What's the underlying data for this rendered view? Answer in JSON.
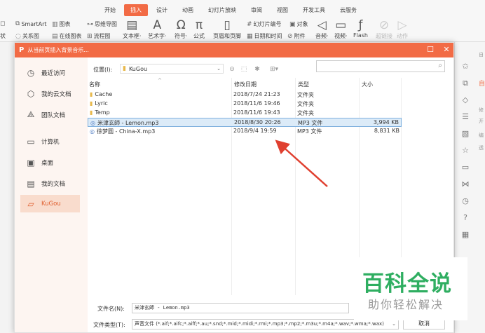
{
  "ribbon": {
    "tabs": [
      "开始",
      "插入",
      "设计",
      "动画",
      "幻灯片放映",
      "审阅",
      "视图",
      "开发工具",
      "云服务"
    ],
    "active_tab": "插入",
    "small_tools": {
      "smartart": "SmartArt",
      "chart": "图表",
      "mindmap": "思维导图",
      "relation": "关系图",
      "online_chart": "在线图表",
      "flowchart": "流程图",
      "slide_number": "幻灯片编号",
      "object": "对象",
      "date_time": "日期和时间",
      "attachment": "附件",
      "left_cut_top": "",
      "left_cut_bottom": "状"
    },
    "big_tools": [
      "文本框·",
      "艺术字·",
      "符号·",
      "公式",
      "页眉和页脚",
      "音频·",
      "视频·",
      "Flash",
      "超链接",
      "动作"
    ]
  },
  "right_pane": {
    "texts": [
      "自",
      "自",
      "修",
      "开",
      "编",
      "透"
    ]
  },
  "dialog": {
    "title": "从当前页插入背景音乐...",
    "sidebar": [
      "最近访问",
      "我的云文档",
      "团队文档",
      "计算机",
      "桌面",
      "我的文档",
      "KuGou"
    ],
    "active_sidebar": "KuGou",
    "location_label": "位置(I):",
    "location_value": "KuGou",
    "columns": {
      "name": "名称",
      "modified": "修改日期",
      "type": "类型",
      "size": "大小"
    },
    "files": [
      {
        "name": "Cache",
        "modified": "2018/7/24 21:23",
        "type": "文件夹",
        "size": "",
        "kind": "folder"
      },
      {
        "name": "Lyric",
        "modified": "2018/11/6 19:46",
        "type": "文件夹",
        "size": "",
        "kind": "folder"
      },
      {
        "name": "Temp",
        "modified": "2018/11/6 19:43",
        "type": "文件夹",
        "size": "",
        "kind": "folder"
      },
      {
        "name": "米津玄師 - Lemon.mp3",
        "modified": "2018/8/30 20:26",
        "type": "MP3 文件",
        "size": "3,994 KB",
        "kind": "mp3",
        "selected": true
      },
      {
        "name": "徐梦圆 - China-X.mp3",
        "modified": "2018/9/4 19:59",
        "type": "MP3 文件",
        "size": "8,831 KB",
        "kind": "mp3"
      }
    ],
    "filename_label": "文件名(N):",
    "filename_value": "米津玄師 - Lemon.mp3",
    "filetype_label": "文件类型(T):",
    "filetype_value": "声音文件 (*.aif;*.aifc;*.aiff;*.au;*.snd;*.mid;*.midi;*.rmi;*.mp3;*.mp2;*.m3u;*.m4a;*.wav;*.wma;*.wax)",
    "cancel_label": "取消"
  },
  "watermark": {
    "title": "百科全说",
    "subtitle": "助你轻松解决"
  },
  "colors": {
    "accent": "#f26b45",
    "watermark_green": "#2fae61",
    "selection": "#dcebf8"
  }
}
